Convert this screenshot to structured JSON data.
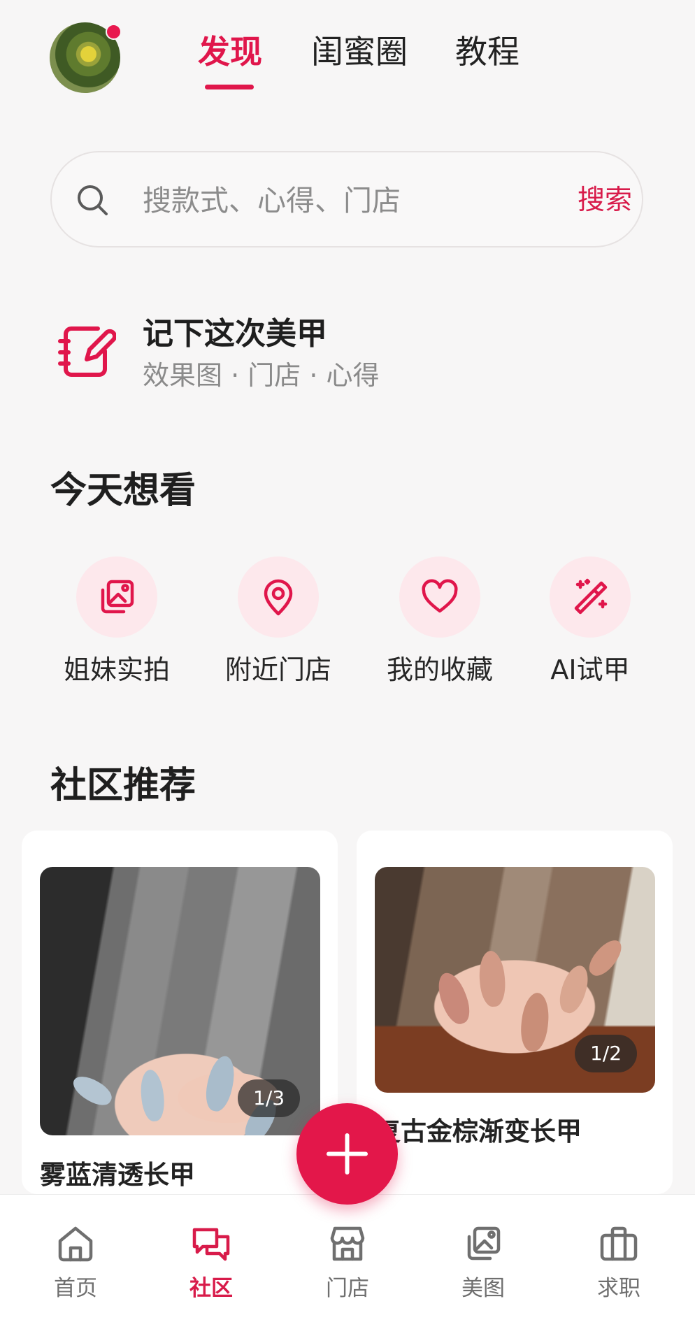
{
  "header": {
    "tabs": [
      {
        "label": "发现",
        "active": true
      },
      {
        "label": "闺蜜圈",
        "active": false
      },
      {
        "label": "教程",
        "active": false
      }
    ],
    "avatar_notification": true
  },
  "search": {
    "placeholder": "搜款式、心得、门店",
    "button_label": "搜索"
  },
  "record": {
    "title": "记下这次美甲",
    "subtitle": "效果图 · 门店 · 心得"
  },
  "today": {
    "title": "今天想看",
    "items": [
      {
        "label": "姐妹实拍",
        "icon": "photo-gallery-icon"
      },
      {
        "label": "附近门店",
        "icon": "location-pin-icon"
      },
      {
        "label": "我的收藏",
        "icon": "heart-icon"
      },
      {
        "label": "AI试甲",
        "icon": "magic-wand-icon"
      }
    ]
  },
  "community": {
    "title": "社区推荐",
    "posts": [
      {
        "title": "雾蓝清透长甲",
        "counter": "1/3"
      },
      {
        "title": "复古金棕渐变长甲",
        "counter": "1/2"
      }
    ]
  },
  "bottom_nav": [
    {
      "label": "首页",
      "icon": "home-icon",
      "active": false
    },
    {
      "label": "社区",
      "icon": "chat-bubbles-icon",
      "active": true
    },
    {
      "label": "门店",
      "icon": "store-icon",
      "active": false
    },
    {
      "label": "美图",
      "icon": "photo-icon",
      "active": false
    },
    {
      "label": "求职",
      "icon": "briefcase-icon",
      "active": false
    }
  ],
  "colors": {
    "accent": "#e0164b",
    "accent_light": "#fde8ec",
    "background": "#f7f6f6"
  }
}
